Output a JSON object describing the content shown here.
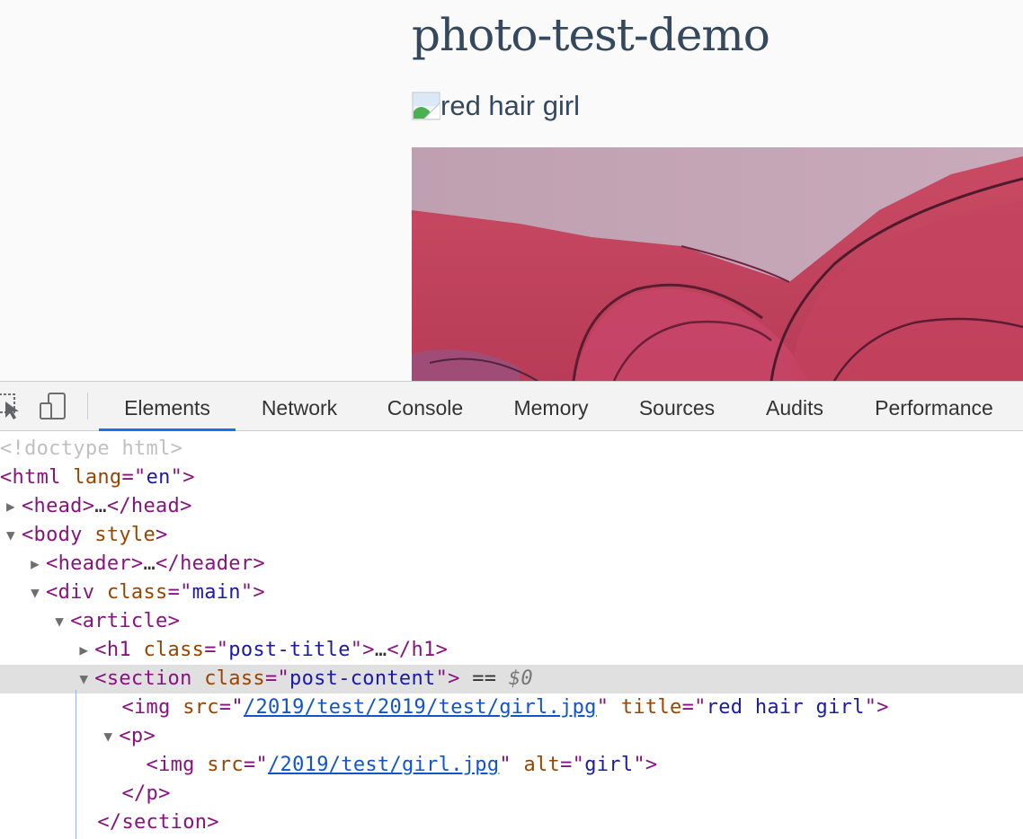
{
  "page": {
    "title": "photo-test-demo",
    "broken_image_alt": "red hair girl"
  },
  "devtools": {
    "tabs": [
      {
        "label": "Elements",
        "active": true
      },
      {
        "label": "Network"
      },
      {
        "label": "Console"
      },
      {
        "label": "Memory"
      },
      {
        "label": "Sources"
      },
      {
        "label": "Audits"
      },
      {
        "label": "Performance"
      }
    ],
    "icons": [
      "inspect-element-icon",
      "device-toolbar-icon"
    ],
    "tree": {
      "doctype": "<!doctype html>",
      "html": {
        "tag": "html",
        "attr": "lang",
        "val": "en"
      },
      "head": {
        "open": "head",
        "ellipsis": "…",
        "close": "head"
      },
      "body": {
        "tag": "body",
        "attr": "style"
      },
      "header": {
        "open": "header",
        "ellipsis": "…",
        "close": "header"
      },
      "div": {
        "tag": "div",
        "attr": "class",
        "val": "main"
      },
      "article": {
        "tag": "article"
      },
      "h1": {
        "tag": "h1",
        "attr": "class",
        "val": "post-title",
        "ellipsis": "…",
        "close": "h1"
      },
      "section": {
        "tag": "section",
        "attr": "class",
        "val": "post-content",
        "marker": "== ",
        "dollar": "$0"
      },
      "img1": {
        "tag": "img",
        "attr1": "src",
        "src": "/2019/test/2019/test/girl.jpg",
        "attr2": "title",
        "title": "red hair girl"
      },
      "p": {
        "tag": "p"
      },
      "img2": {
        "tag": "img",
        "attr1": "src",
        "src": "/2019/test/girl.jpg",
        "attr2": "alt",
        "alt": "girl"
      },
      "p_close": "p",
      "section_close": "section"
    }
  },
  "colors": {
    "title": "#34495e",
    "tag": "#881280",
    "attr": "#994500",
    "value": "#1a1aa6",
    "link": "#1155cc",
    "active_tab_underline": "#1a73e8"
  }
}
